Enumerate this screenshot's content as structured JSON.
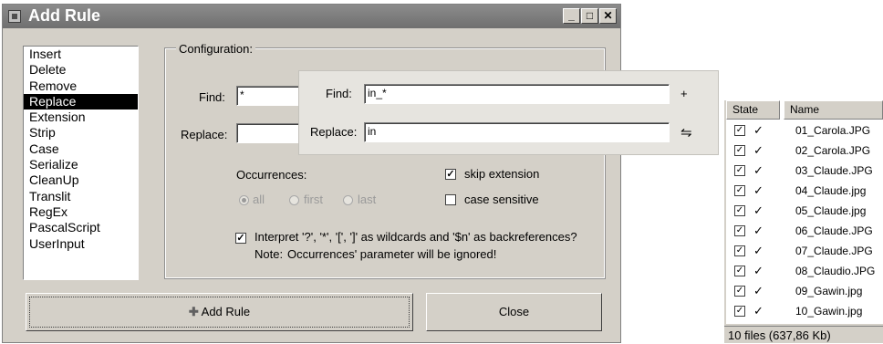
{
  "window": {
    "title": "Add Rule",
    "controls": {
      "minimize": "_",
      "maximize": "□",
      "close": "✕"
    }
  },
  "rules_list": {
    "items": [
      "Insert",
      "Delete",
      "Remove",
      "Replace",
      "Extension",
      "Strip",
      "Case",
      "Serialize",
      "CleanUp",
      "Translit",
      "RegEx",
      "PascalScript",
      "UserInput"
    ],
    "selected": "Replace"
  },
  "configuration": {
    "group_label": "Configuration:",
    "find_label": "Find:",
    "find_value": "*",
    "replace_label": "Replace:",
    "replace_value": "",
    "occurrences_label": "Occurrences:",
    "occ_all": "all",
    "occ_first": "first",
    "occ_last": "last",
    "skip_extension_label": "skip extension",
    "skip_extension_checked": true,
    "case_sensitive_label": "case sensitive",
    "case_sensitive_checked": false,
    "wildcards_label": "Interpret '?', '*', '[', ']' as wildcards and '$n' as backreferences?",
    "wildcards_checked": true,
    "note_prefix": "Note:",
    "note_text": "Occurrences' parameter will be ignored!"
  },
  "buttons": {
    "add_rule": "Add Rule",
    "close": "Close"
  },
  "zoom_overlay": {
    "find_label": "Find:",
    "find_value": "in_*",
    "find_side_button": "+",
    "replace_label": "Replace:",
    "replace_value": "in",
    "replace_side_button": "⇋"
  },
  "file_list": {
    "columns": {
      "state": "State",
      "name": "Name"
    },
    "rows": [
      {
        "name": "01_Carola.JPG"
      },
      {
        "name": "02_Carola.JPG"
      },
      {
        "name": "03_Claude.JPG"
      },
      {
        "name": "04_Claude.jpg"
      },
      {
        "name": "05_Claude.jpg"
      },
      {
        "name": "06_Claude.JPG"
      },
      {
        "name": "07_Claude.JPG"
      },
      {
        "name": "08_Claudio.JPG"
      },
      {
        "name": "09_Gawin.jpg"
      },
      {
        "name": "10_Gawin.jpg"
      }
    ],
    "status": "10 files (637,86 Kb)"
  }
}
